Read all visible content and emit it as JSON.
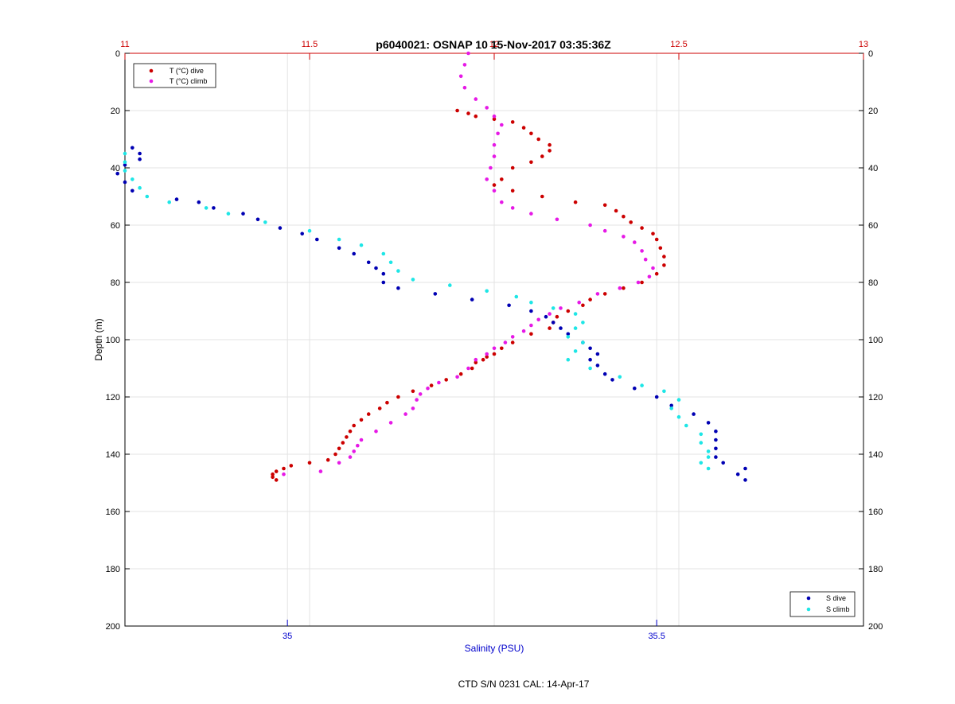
{
  "chart_data": {
    "type": "scatter",
    "title": "p6040021: OSNAP 10 15-Nov-2017 03:35:36Z",
    "footer": "CTD S/N 0231  CAL: 14-Apr-17",
    "ylabel": "Depth (m)",
    "xlabel": "Salinity (PSU)",
    "ylim": [
      0,
      200
    ],
    "y_reversed": true,
    "y_ticks": [
      0,
      20,
      40,
      60,
      80,
      100,
      120,
      140,
      160,
      180,
      200
    ],
    "temp_axis": {
      "position": "top",
      "range": [
        11,
        13
      ],
      "ticks": [
        "11",
        "11.5",
        "12",
        "12.5",
        "13"
      ],
      "tick_values": [
        11,
        11.5,
        12,
        12.5,
        13
      ],
      "color": "#cc0000"
    },
    "salinity_axis": {
      "position": "bottom",
      "range": [
        34.78,
        35.78
      ],
      "ticks": [
        "35",
        "35.5"
      ],
      "tick_values": [
        35,
        35.5
      ],
      "color": "#0000cc"
    },
    "grid": true,
    "legends": [
      {
        "placement": "top-left",
        "entries": [
          {
            "label": "T (°C) dive",
            "color": "#cc0000"
          },
          {
            "label": "T (°C) climb",
            "color": "#e619e6"
          }
        ]
      },
      {
        "placement": "bottom-right",
        "entries": [
          {
            "label": "S dive",
            "color": "#0000b3"
          },
          {
            "label": "S climb",
            "color": "#1ee6e6"
          }
        ]
      }
    ],
    "series": [
      {
        "name": "T (°C) dive",
        "axis": "temp",
        "color": "#cc0000",
        "points": [
          [
            11.9,
            20
          ],
          [
            11.93,
            21
          ],
          [
            11.95,
            22
          ],
          [
            12.0,
            23
          ],
          [
            12.05,
            24
          ],
          [
            12.08,
            26
          ],
          [
            12.1,
            28
          ],
          [
            12.12,
            30
          ],
          [
            12.15,
            32
          ],
          [
            12.15,
            34
          ],
          [
            12.13,
            36
          ],
          [
            12.1,
            38
          ],
          [
            12.05,
            40
          ],
          [
            12.02,
            44
          ],
          [
            12.0,
            46
          ],
          [
            12.05,
            48
          ],
          [
            12.13,
            50
          ],
          [
            12.22,
            52
          ],
          [
            12.3,
            53
          ],
          [
            12.33,
            55
          ],
          [
            12.35,
            57
          ],
          [
            12.37,
            59
          ],
          [
            12.4,
            61
          ],
          [
            12.43,
            63
          ],
          [
            12.44,
            65
          ],
          [
            12.45,
            68
          ],
          [
            12.46,
            71
          ],
          [
            12.46,
            74
          ],
          [
            12.44,
            77
          ],
          [
            12.4,
            80
          ],
          [
            12.35,
            82
          ],
          [
            12.3,
            84
          ],
          [
            12.26,
            86
          ],
          [
            12.24,
            88
          ],
          [
            12.2,
            90
          ],
          [
            12.17,
            92
          ],
          [
            12.16,
            94
          ],
          [
            12.15,
            96
          ],
          [
            12.1,
            98
          ],
          [
            12.05,
            101
          ],
          [
            12.02,
            103
          ],
          [
            12.0,
            105
          ],
          [
            11.98,
            106
          ],
          [
            11.97,
            107
          ],
          [
            11.95,
            108
          ],
          [
            11.94,
            110
          ],
          [
            11.91,
            112
          ],
          [
            11.87,
            114
          ],
          [
            11.83,
            116
          ],
          [
            11.78,
            118
          ],
          [
            11.74,
            120
          ],
          [
            11.71,
            122
          ],
          [
            11.69,
            124
          ],
          [
            11.66,
            126
          ],
          [
            11.64,
            128
          ],
          [
            11.62,
            130
          ],
          [
            11.61,
            132
          ],
          [
            11.6,
            134
          ],
          [
            11.59,
            136
          ],
          [
            11.58,
            138
          ],
          [
            11.57,
            140
          ],
          [
            11.55,
            142
          ],
          [
            11.5,
            143
          ],
          [
            11.45,
            144
          ],
          [
            11.43,
            145
          ],
          [
            11.41,
            146
          ],
          [
            11.4,
            147
          ],
          [
            11.4,
            148
          ],
          [
            11.41,
            149
          ]
        ]
      },
      {
        "name": "T (°C) climb",
        "axis": "temp",
        "color": "#e619e6",
        "points": [
          [
            11.93,
            0
          ],
          [
            11.92,
            4
          ],
          [
            11.91,
            8
          ],
          [
            11.92,
            12
          ],
          [
            11.95,
            16
          ],
          [
            11.98,
            19
          ],
          [
            12.0,
            22
          ],
          [
            12.02,
            25
          ],
          [
            12.01,
            28
          ],
          [
            12.0,
            32
          ],
          [
            12.0,
            36
          ],
          [
            11.99,
            40
          ],
          [
            11.98,
            44
          ],
          [
            12.0,
            48
          ],
          [
            12.02,
            52
          ],
          [
            12.05,
            54
          ],
          [
            12.1,
            56
          ],
          [
            12.17,
            58
          ],
          [
            12.26,
            60
          ],
          [
            12.3,
            62
          ],
          [
            12.35,
            64
          ],
          [
            12.38,
            66
          ],
          [
            12.4,
            69
          ],
          [
            12.41,
            72
          ],
          [
            12.43,
            75
          ],
          [
            12.42,
            78
          ],
          [
            12.39,
            80
          ],
          [
            12.34,
            82
          ],
          [
            12.28,
            84
          ],
          [
            12.23,
            87
          ],
          [
            12.18,
            89
          ],
          [
            12.15,
            91
          ],
          [
            12.12,
            93
          ],
          [
            12.1,
            95
          ],
          [
            12.08,
            97
          ],
          [
            12.05,
            99
          ],
          [
            12.03,
            101
          ],
          [
            12.0,
            103
          ],
          [
            11.98,
            105
          ],
          [
            11.95,
            107
          ],
          [
            11.93,
            110
          ],
          [
            11.9,
            113
          ],
          [
            11.85,
            115
          ],
          [
            11.82,
            117
          ],
          [
            11.8,
            119
          ],
          [
            11.79,
            121
          ],
          [
            11.78,
            124
          ],
          [
            11.76,
            126
          ],
          [
            11.72,
            129
          ],
          [
            11.68,
            132
          ],
          [
            11.64,
            135
          ],
          [
            11.63,
            137
          ],
          [
            11.62,
            139
          ],
          [
            11.61,
            141
          ],
          [
            11.58,
            143
          ],
          [
            11.53,
            146
          ],
          [
            11.43,
            147
          ]
        ]
      },
      {
        "name": "S dive",
        "axis": "salinity",
        "color": "#0000b3",
        "points": [
          [
            34.79,
            33
          ],
          [
            34.8,
            35
          ],
          [
            34.8,
            37
          ],
          [
            34.78,
            39
          ],
          [
            34.77,
            42
          ],
          [
            34.78,
            45
          ],
          [
            34.79,
            48
          ],
          [
            34.85,
            51
          ],
          [
            34.88,
            52
          ],
          [
            34.9,
            54
          ],
          [
            34.94,
            56
          ],
          [
            34.96,
            58
          ],
          [
            34.99,
            61
          ],
          [
            35.02,
            63
          ],
          [
            35.04,
            65
          ],
          [
            35.07,
            68
          ],
          [
            35.09,
            70
          ],
          [
            35.11,
            73
          ],
          [
            35.12,
            75
          ],
          [
            35.13,
            77
          ],
          [
            35.13,
            80
          ],
          [
            35.15,
            82
          ],
          [
            35.2,
            84
          ],
          [
            35.25,
            86
          ],
          [
            35.3,
            88
          ],
          [
            35.33,
            90
          ],
          [
            35.35,
            92
          ],
          [
            35.36,
            94
          ],
          [
            35.37,
            96
          ],
          [
            35.38,
            98
          ],
          [
            35.4,
            101
          ],
          [
            35.41,
            103
          ],
          [
            35.42,
            105
          ],
          [
            35.41,
            107
          ],
          [
            35.42,
            109
          ],
          [
            35.43,
            112
          ],
          [
            35.44,
            114
          ],
          [
            35.47,
            117
          ],
          [
            35.5,
            120
          ],
          [
            35.52,
            123
          ],
          [
            35.55,
            126
          ],
          [
            35.57,
            129
          ],
          [
            35.58,
            132
          ],
          [
            35.58,
            135
          ],
          [
            35.58,
            138
          ],
          [
            35.58,
            141
          ],
          [
            35.59,
            143
          ],
          [
            35.62,
            145
          ],
          [
            35.61,
            147
          ],
          [
            35.62,
            149
          ]
        ]
      },
      {
        "name": "S climb",
        "axis": "salinity",
        "color": "#1ee6e6",
        "points": [
          [
            34.78,
            35
          ],
          [
            34.78,
            38
          ],
          [
            34.78,
            41
          ],
          [
            34.79,
            44
          ],
          [
            34.8,
            47
          ],
          [
            34.81,
            50
          ],
          [
            34.84,
            52
          ],
          [
            34.89,
            54
          ],
          [
            34.92,
            56
          ],
          [
            34.97,
            59
          ],
          [
            35.03,
            62
          ],
          [
            35.07,
            65
          ],
          [
            35.1,
            67
          ],
          [
            35.13,
            70
          ],
          [
            35.14,
            73
          ],
          [
            35.15,
            76
          ],
          [
            35.17,
            79
          ],
          [
            35.22,
            81
          ],
          [
            35.27,
            83
          ],
          [
            35.31,
            85
          ],
          [
            35.33,
            87
          ],
          [
            35.36,
            89
          ],
          [
            35.39,
            91
          ],
          [
            35.4,
            94
          ],
          [
            35.39,
            96
          ],
          [
            35.38,
            99
          ],
          [
            35.4,
            101
          ],
          [
            35.39,
            104
          ],
          [
            35.38,
            107
          ],
          [
            35.41,
            110
          ],
          [
            35.45,
            113
          ],
          [
            35.48,
            116
          ],
          [
            35.51,
            118
          ],
          [
            35.53,
            121
          ],
          [
            35.52,
            124
          ],
          [
            35.53,
            127
          ],
          [
            35.54,
            130
          ],
          [
            35.56,
            133
          ],
          [
            35.56,
            136
          ],
          [
            35.57,
            139
          ],
          [
            35.57,
            141
          ],
          [
            35.56,
            143
          ],
          [
            35.57,
            145
          ]
        ]
      }
    ]
  }
}
